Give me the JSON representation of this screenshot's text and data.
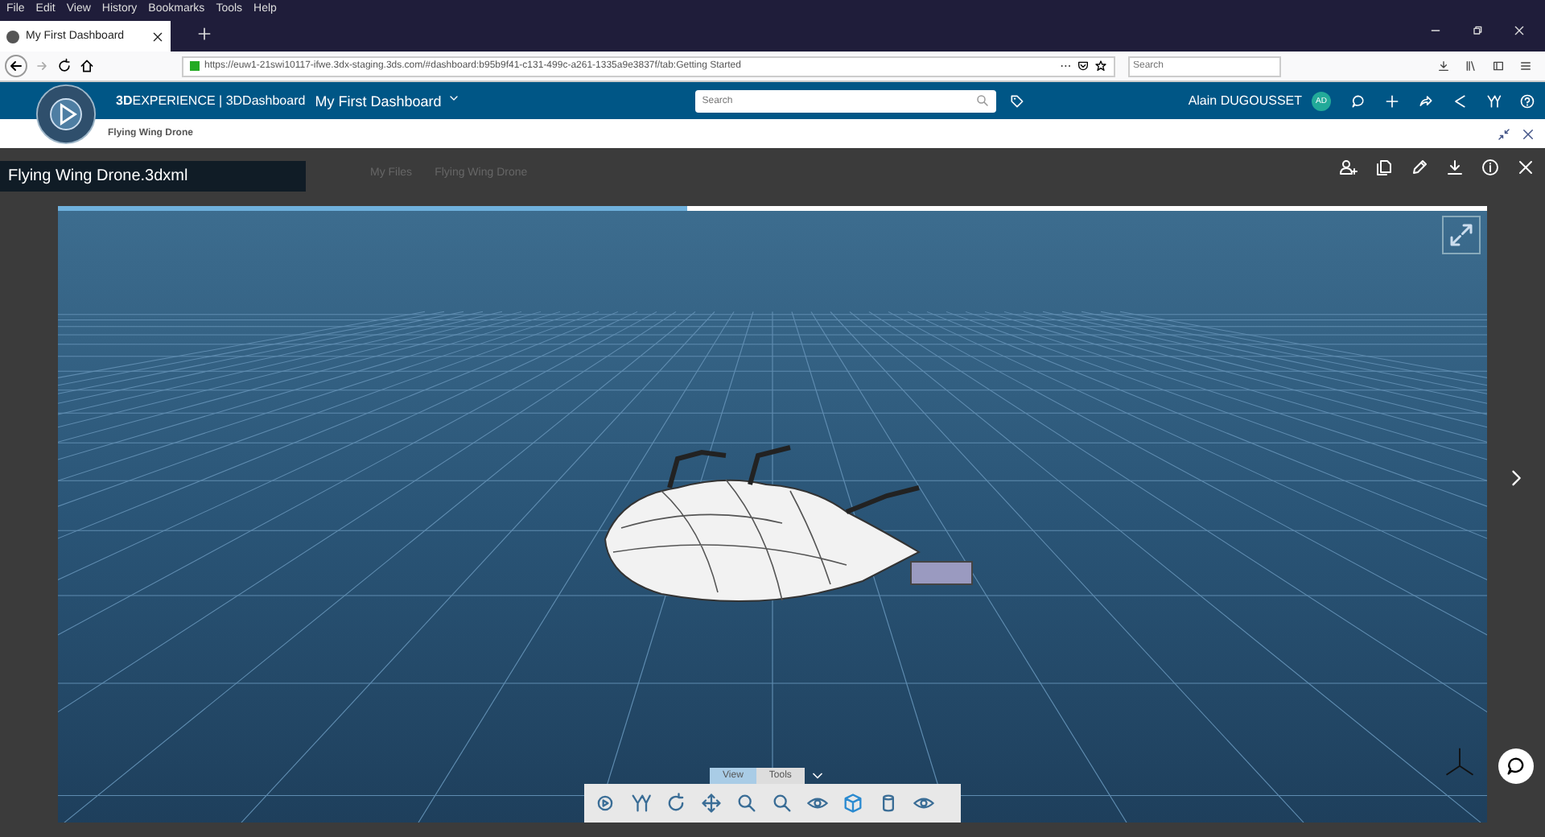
{
  "browser": {
    "menu": [
      "File",
      "Edit",
      "View",
      "History",
      "Bookmarks",
      "Tools",
      "Help"
    ],
    "tab": {
      "title": "My First Dashboard"
    },
    "url": "https://euw1-21swi10117-ifwe.3dx-staging.3ds.com/#dashboard:b95b9f41-c131-499c-a261-1335a9e3837f/tab:Getting Started",
    "search": {
      "placeholder": "Search"
    }
  },
  "app": {
    "brand": "**3D**EXPERIENCE | 3DDashboard",
    "dashboard": "My First Dashboard",
    "search": {
      "placeholder": "Search"
    },
    "user": "Alain DUGOUSSET",
    "initials": "AD"
  },
  "subheader": {
    "title": "Flying Wing Drone"
  },
  "background": {
    "breadcrumbs": [
      "My Files",
      "Flying Wing Drone"
    ]
  },
  "viewer": {
    "title": "Flying Wing Drone.3dxml",
    "loading": {
      "level": 0.44
    },
    "toolbar_tabs": [
      {
        "label": "View",
        "selected": true
      },
      {
        "label": "Tools",
        "selected": false
      }
    ]
  }
}
